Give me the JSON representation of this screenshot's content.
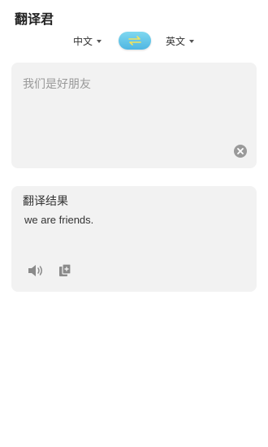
{
  "app": {
    "title": "翻译君"
  },
  "langs": {
    "source": "中文",
    "target": "英文"
  },
  "input": {
    "text": "我们是好朋友"
  },
  "result": {
    "title": "翻译结果",
    "text": "we are friends."
  },
  "icons": {
    "swap": "swap-arrows-icon",
    "clear": "clear-icon",
    "speaker": "speaker-icon",
    "copy": "copy-icon"
  },
  "colors": {
    "accent": "#4fb6e2",
    "card": "#f2f2f2"
  }
}
